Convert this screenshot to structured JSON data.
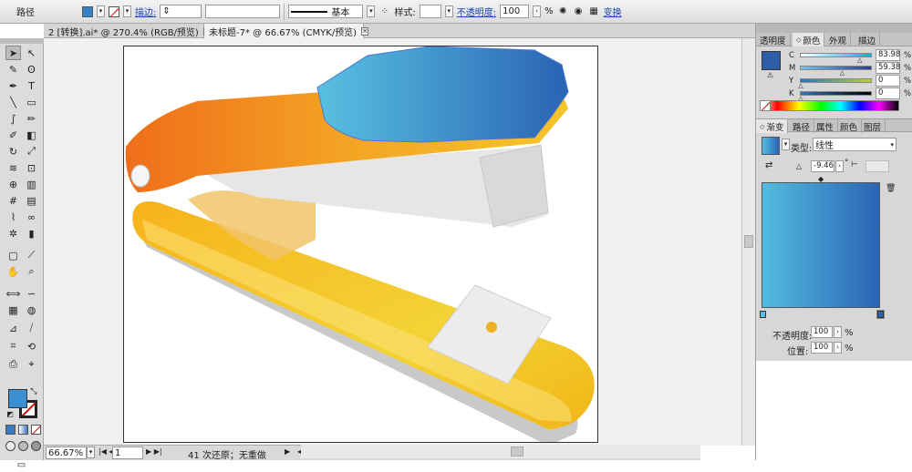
{
  "control_bar": {
    "selection_label": "路径",
    "stroke_label": "描边:",
    "stroke_profile": "基本",
    "style_label": "样式:",
    "opacity_label": "不透明度:",
    "opacity_value": "100",
    "opacity_unit": "%",
    "transform_label": "变换",
    "fill_color": "#3a82c8",
    "stroke_indicator": "none"
  },
  "document_tabs": [
    {
      "title": "2 [转换].ai* @ 270.4% (RGB/预览)",
      "close": "×"
    },
    {
      "title": "未标题-7* @ 66.67% (CMYK/预览)",
      "close": "×"
    }
  ],
  "tools": {
    "fill_color": "#3c8fd0",
    "rows": [
      [
        "selection-icon",
        "direct-selection-icon"
      ],
      [
        "magic-wand-icon",
        "lasso-icon"
      ],
      [
        "pen-icon",
        "type-icon"
      ],
      [
        "line-segment-icon",
        "rectangle-icon"
      ],
      [
        "paintbrush-icon",
        "pencil-icon"
      ],
      [
        "blob-brush-icon",
        "eraser-icon"
      ],
      [
        "rotate-icon",
        "scale-icon"
      ],
      [
        "warp-icon",
        "free-transform-icon"
      ],
      [
        "shape-builder-icon",
        "perspective-grid-icon"
      ],
      [
        "mesh-icon",
        "gradient-icon"
      ],
      [
        "eyedropper-icon",
        "blend-icon"
      ],
      [
        "symbol-sprayer-icon",
        "column-graph-icon"
      ],
      [
        "artboard-icon",
        "slice-icon"
      ],
      [
        "hand-icon",
        "zoom-icon"
      ]
    ]
  },
  "status_bar": {
    "zoom": "66.67%",
    "page": "1",
    "history": "41 次还原；无重做"
  },
  "color_panel": {
    "tabs": [
      "透明度",
      "颜色",
      "外观",
      "描边"
    ],
    "active_tab": "颜色",
    "channels": [
      {
        "name": "C",
        "value": "83.98",
        "level": 0.84,
        "gradient": "linear-gradient(90deg,#ffffff,#00aeef)"
      },
      {
        "name": "M",
        "value": "59.38",
        "level": 0.59,
        "gradient": "linear-gradient(90deg,#6fc5ee,#2f3b8e)"
      },
      {
        "name": "Y",
        "value": "0",
        "level": 0.0,
        "gradient": "linear-gradient(90deg,#2b75c0,#b9d13a)"
      },
      {
        "name": "K",
        "value": "0",
        "level": 0.0,
        "gradient": "linear-gradient(90deg,#2b75c0,#000000)"
      }
    ],
    "current_color": "#2e5ea8"
  },
  "gradient_panel": {
    "tabs": [
      "渐变",
      "路径",
      "属性",
      "颜色",
      "图层"
    ],
    "active_tab": "渐变",
    "type_label": "类型:",
    "type_value": "线性",
    "angle_value": "-9.46",
    "angle_unit": "°",
    "start_color": "#52bde0",
    "end_color": "#2a63b4",
    "opacity_label": "不透明度:",
    "opacity_value": "100",
    "opacity_unit": "%",
    "location_label": "位置:",
    "location_value": "100",
    "location_unit": "%"
  }
}
